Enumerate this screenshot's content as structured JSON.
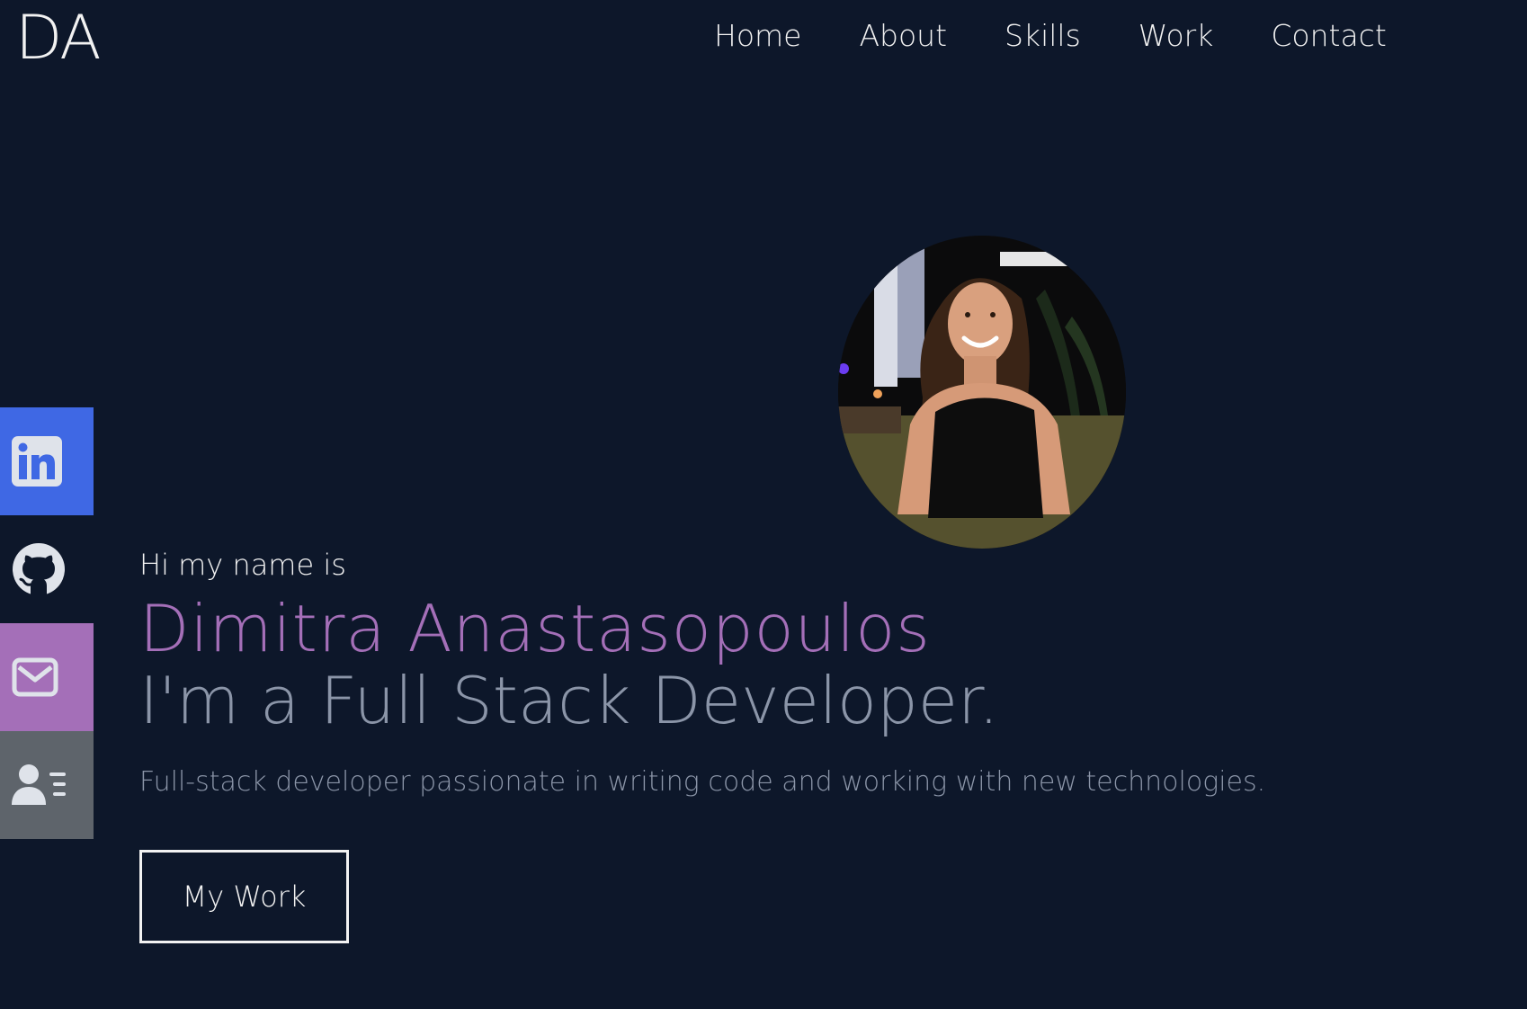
{
  "header": {
    "logo": "DA",
    "nav": [
      "Home",
      "About",
      "Skills",
      "Work",
      "Contact"
    ]
  },
  "social": [
    {
      "name": "linkedin-icon",
      "color": "#3f68e4"
    },
    {
      "name": "github-icon",
      "color": "transparent"
    },
    {
      "name": "mail-icon",
      "color": "#a46fb8"
    },
    {
      "name": "resume-icon",
      "color": "#5e646b"
    }
  ],
  "hero": {
    "greeting": "Hi my name is",
    "name": "Dimitra Anastasopoulos",
    "role": "I'm a Full Stack Developer.",
    "description": "Full-stack developer passionate in writing code and working with new technologies.",
    "button": "My Work"
  },
  "colors": {
    "background": "#0d172a",
    "accent": "#a46fb8",
    "muted": "#8b95a8",
    "linkedin": "#3f68e4",
    "resume": "#5e646b"
  }
}
